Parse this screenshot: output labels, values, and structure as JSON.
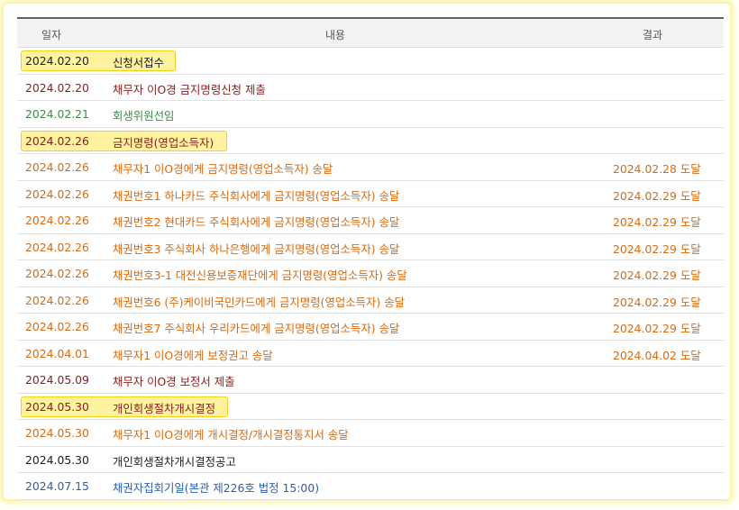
{
  "table": {
    "headers": {
      "date": "일자",
      "content": "내용",
      "result": "결과"
    },
    "rows": [
      {
        "date": "2024.02.20",
        "content": "신청서접수",
        "result": "",
        "color": "#1e1e1e",
        "highlight": true,
        "hlw": 170
      },
      {
        "date": "2024.02.20",
        "content": "채무자 이O경 금지명령신청 제출",
        "result": "",
        "color": "#8a1d1d",
        "highlight": false
      },
      {
        "date": "2024.02.21",
        "content": "회생위원선임",
        "result": "",
        "color": "#3c8a4d",
        "highlight": false
      },
      {
        "date": "2024.02.26",
        "content": "금지명령(영업소득자)",
        "result": "",
        "color": "#8a1d1d",
        "highlight": true,
        "hlw": 227
      },
      {
        "date": "2024.02.26",
        "content": "채무자1 이O경에게 금지명령(영업소득자) 송달",
        "result": "2024.02.28 도달",
        "color": "#d86a10",
        "highlight": false
      },
      {
        "date": "2024.02.26",
        "content": "채권번호1 하나카드 주식회사에게 금지명령(영업소득자) 송달",
        "result": "2024.02.29 도달",
        "color": "#d86a10",
        "highlight": false
      },
      {
        "date": "2024.02.26",
        "content": "채권번호2 현대카드 주식회사에게 금지명령(영업소득자) 송달",
        "result": "2024.02.29 도달",
        "color": "#d86a10",
        "highlight": false
      },
      {
        "date": "2024.02.26",
        "content": "채권번호3 주식회사 하나은행에게 금지명령(영업소득자) 송달",
        "result": "2024.02.29 도달",
        "color": "#d86a10",
        "highlight": false
      },
      {
        "date": "2024.02.26",
        "content": "채권번호3-1 대전신용보증재단에게 금지명령(영업소득자) 송달",
        "result": "2024.02.29 도달",
        "color": "#d86a10",
        "highlight": false
      },
      {
        "date": "2024.02.26",
        "content": "채권번호6 (주)케이비국민카드에게 금지명령(영업소득자) 송달",
        "result": "2024.02.29 도달",
        "color": "#d86a10",
        "highlight": false
      },
      {
        "date": "2024.02.26",
        "content": "채권번호7 주식회사 우리카드에게 금지명령(영업소득자) 송달",
        "result": "2024.02.29 도달",
        "color": "#d86a10",
        "highlight": false
      },
      {
        "date": "2024.04.01",
        "content": "채무자1 이O경에게 보정권고 송달",
        "result": "2024.04.02 도달",
        "color": "#d86a10",
        "highlight": false
      },
      {
        "date": "2024.05.09",
        "content": "채무자 이O경 보정서 제출",
        "result": "",
        "color": "#8a1d1d",
        "highlight": false
      },
      {
        "date": "2024.05.30",
        "content": "개인회생절차개시결정",
        "result": "",
        "color": "#8a1d1d",
        "highlight": true,
        "hlw": 228
      },
      {
        "date": "2024.05.30",
        "content": "채무자1 이O경에게 개시결정/개시결정통지서 송달",
        "result": "",
        "color": "#d86a10",
        "highlight": false
      },
      {
        "date": "2024.05.30",
        "content": "개인회생절차개시결정공고",
        "result": "",
        "color": "#1e1e1e",
        "highlight": false
      },
      {
        "date": "2024.07.15",
        "content": "채권자집회기일(본관 제226호 법정 15:00)",
        "result": "",
        "color": "#2a5fb0",
        "highlight": false
      }
    ]
  }
}
